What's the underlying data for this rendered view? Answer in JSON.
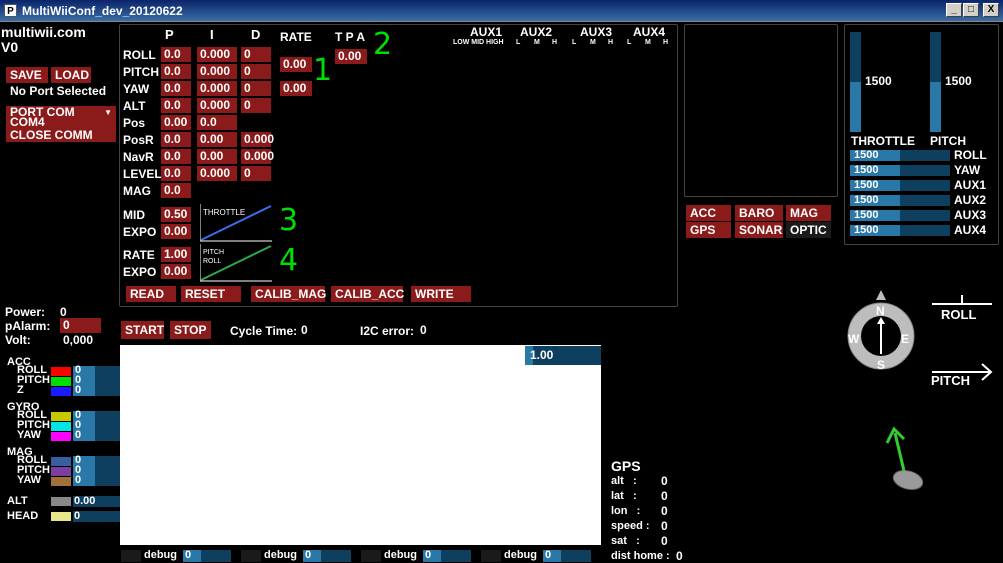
{
  "window": {
    "title": "MultiWiiConf_dev_20120622",
    "app_icon": "P",
    "min": "_",
    "max": "□",
    "close": "X"
  },
  "brand": {
    "line1": "multiwii.com",
    "line2": "V0"
  },
  "conn": {
    "save": "SAVE",
    "load": "LOAD",
    "no_port": "No Port Selected",
    "port_com": "PORT COM",
    "com4": "COM4",
    "close_comm": "CLOSE COMM"
  },
  "pid": {
    "headers": [
      "P",
      "I",
      "D"
    ],
    "rate": "RATE",
    "tpa": "T P A",
    "rows": [
      {
        "name": "ROLL",
        "p": "0.0",
        "i": "0.000",
        "d": "0"
      },
      {
        "name": "PITCH",
        "p": "0.0",
        "i": "0.000",
        "d": "0"
      },
      {
        "name": "YAW",
        "p": "0.0",
        "i": "0.000",
        "d": "0"
      },
      {
        "name": "ALT",
        "p": "0.0",
        "i": "0.000",
        "d": "0"
      },
      {
        "name": "Pos",
        "p": "0.00",
        "i": "0.0",
        "d": ""
      },
      {
        "name": "PosR",
        "p": "0.0",
        "i": "0.00",
        "d": "0.000"
      },
      {
        "name": "NavR",
        "p": "0.0",
        "i": "0.00",
        "d": "0.000"
      },
      {
        "name": "LEVEL",
        "p": "0.0",
        "i": "0.000",
        "d": "0"
      },
      {
        "name": "MAG",
        "p": "0.0",
        "i": "",
        "d": ""
      }
    ],
    "rate_rp": "0.00",
    "rate_yaw": "0.00",
    "tpa_val": "0.00",
    "ann1": "1",
    "ann2": "2",
    "ann3": "3",
    "ann4": "4"
  },
  "curves": {
    "mid_label": "MID",
    "mid_val": "0.50",
    "expo_label": "EXPO",
    "expo_val": "0.00",
    "throttle": "THROTTLE",
    "rate_label": "RATE",
    "rate_val": "1.00",
    "expo2_label": "EXPO",
    "expo2_val": "0.00",
    "pitch": "PITCH",
    "roll": "ROLL",
    "throttle_color": "#3a6ee8",
    "pitchroll_color": "#2ea84a"
  },
  "aux": {
    "titles": [
      "AUX1",
      "AUX2",
      "AUX3",
      "AUX4"
    ],
    "aux1_sub": "LOW MID HIGH",
    "sub": [
      "L",
      "M",
      "H"
    ]
  },
  "actions": {
    "read": "READ",
    "reset": "RESET",
    "calib_mag": "CALIB_MAG",
    "calib_acc": "CALIB_ACC",
    "write": "WRITE"
  },
  "sensors": [
    "ACC",
    "BARO",
    "MAG",
    "GPS",
    "SONAR",
    "OPTIC"
  ],
  "rc": {
    "throttle_label": "THROTTLE",
    "throttle_val": "1500",
    "throttle_level": 0.5,
    "pitch_label": "PITCH",
    "pitch_val": "1500",
    "pitch_level": 0.5,
    "channels": [
      {
        "name": "ROLL",
        "val": "1500"
      },
      {
        "name": "YAW",
        "val": "1500"
      },
      {
        "name": "AUX1",
        "val": "1500"
      },
      {
        "name": "AUX2",
        "val": "1500"
      },
      {
        "name": "AUX3",
        "val": "1500"
      },
      {
        "name": "AUX4",
        "val": "1500"
      }
    ]
  },
  "status": {
    "power_label": "Power:",
    "power_val": "0",
    "palarm_label": "pAlarm:",
    "palarm_val": "0",
    "volt_label": "Volt:",
    "volt_val": "0,000"
  },
  "graph": {
    "start": "START",
    "stop": "STOP",
    "cycle_label": "Cycle Time:",
    "cycle_val": "0",
    "i2c_label": "I2C error:",
    "i2c_val": "0",
    "scale": "1.00"
  },
  "sensor_legend": {
    "acc": {
      "title": "ACC",
      "items": [
        {
          "name": "ROLL",
          "val": "0",
          "color": "#ff0000"
        },
        {
          "name": "PITCH",
          "val": "0",
          "color": "#00dd00"
        },
        {
          "name": "Z",
          "val": "0",
          "color": "#1a1aff"
        }
      ]
    },
    "gyro": {
      "title": "GYRO",
      "items": [
        {
          "name": "ROLL",
          "val": "0",
          "color": "#c8c800"
        },
        {
          "name": "PITCH",
          "val": "0",
          "color": "#00e6e6"
        },
        {
          "name": "YAW",
          "val": "0",
          "color": "#ff00ff"
        }
      ]
    },
    "mag": {
      "title": "MAG",
      "items": [
        {
          "name": "ROLL",
          "val": "0",
          "color": "#3a5fa0"
        },
        {
          "name": "PITCH",
          "val": "0",
          "color": "#7a3fa0"
        },
        {
          "name": "YAW",
          "val": "0",
          "color": "#a0703a"
        }
      ]
    },
    "alt": {
      "title": "ALT",
      "val": "0.00",
      "color": "#888888"
    },
    "head": {
      "title": "HEAD",
      "val": "0",
      "color": "#e6e68a"
    }
  },
  "debug": [
    {
      "label": "debug",
      "val": "0"
    },
    {
      "label": "debug",
      "val": "0"
    },
    {
      "label": "debug",
      "val": "0"
    },
    {
      "label": "debug",
      "val": "0"
    }
  ],
  "gps": {
    "title": "GPS",
    "rows": [
      {
        "label": "alt   :",
        "val": "0"
      },
      {
        "label": "lat   :",
        "val": "0"
      },
      {
        "label": "lon   :",
        "val": "0"
      },
      {
        "label": "speed :",
        "val": "0"
      },
      {
        "label": "sat   :",
        "val": "0"
      },
      {
        "label": "dist home :",
        "val": "0"
      }
    ]
  },
  "attitude": {
    "n": "N",
    "s": "S",
    "e": "E",
    "w": "W",
    "roll": "ROLL",
    "pitch": "PITCH"
  }
}
